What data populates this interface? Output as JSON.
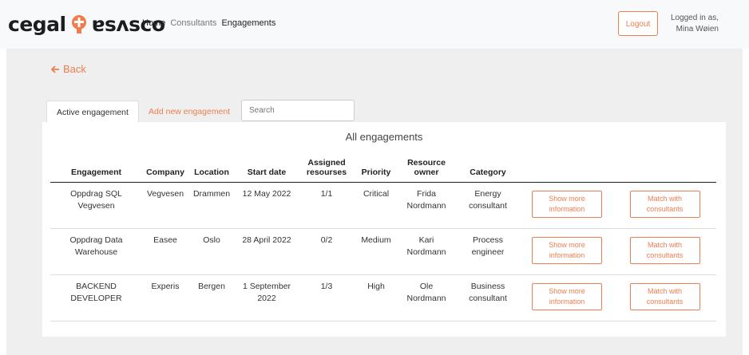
{
  "nav": {
    "brand_left": "cegal",
    "brand_right": "ɐsʌsco",
    "links": [
      "Home",
      "Consultants",
      "Engagements"
    ],
    "logout": "Logout",
    "logged_in_line1": "Logged in as,",
    "logged_in_line2": "Mina Wøien"
  },
  "back_label": "Back",
  "tabs": {
    "active": "Active engagement",
    "add": "Add new engagement"
  },
  "search": {
    "placeholder": "Search"
  },
  "table": {
    "title": "All engagements",
    "headers": [
      "Engagement",
      "Company",
      "Location",
      "Start date",
      "Assigned resourses",
      "Priority",
      "Resource owner",
      "Category"
    ],
    "rows": [
      {
        "engagement": "Oppdrag SQL Vegvesen",
        "company": "Vegvesen",
        "location": "Drammen",
        "start": "12 May 2022",
        "assigned": "1/1",
        "priority": "Critical",
        "owner": "Frida Nordmann",
        "category": "Energy consultant",
        "more": "Show more information",
        "match": "Match with consultants"
      },
      {
        "engagement": "Oppdrag Data Warehouse",
        "company": "Easee",
        "location": "Oslo",
        "start": "28 April 2022",
        "assigned": "0/2",
        "priority": "Medium",
        "owner": "Kari Nordmann",
        "category": "Process engineer",
        "more": "Show more information",
        "match": "Match with consultants"
      },
      {
        "engagement": "BACKEND DEVELOPER",
        "company": "Experis",
        "location": "Bergen",
        "start": "1 September 2022",
        "assigned": "1/3",
        "priority": "High",
        "owner": "Ole Nordmann",
        "category": "Business consultant",
        "more": "Show more information",
        "match": "Match with consultants"
      }
    ]
  },
  "colors": {
    "accent": "#ee7d4f",
    "page_bg": "#efeff0"
  }
}
